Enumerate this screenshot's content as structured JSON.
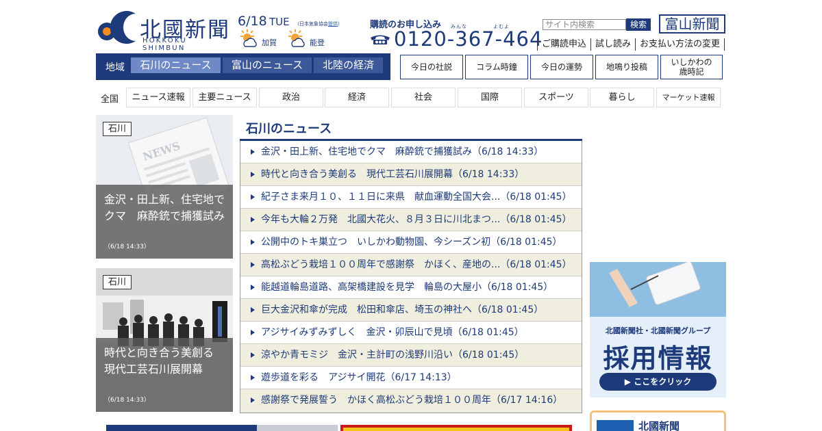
{
  "brand": {
    "name_jp": "北國新聞",
    "name_en": "HOKKOKU SHIMBUN",
    "color_primary": "#1d3a7a"
  },
  "header": {
    "date": "6/18",
    "weekday": "TUE",
    "weather_source_prefix": "（日本気象協会",
    "weather_source_link": "提供",
    "weather_source_suffix": "）",
    "weather": [
      {
        "place": "加賀",
        "icon": "sun-cloud-icon"
      },
      {
        "place": "能登",
        "icon": "sun-cloud-icon"
      }
    ],
    "subscribe_label": "購読のお申し込み",
    "phone_ruby_1": "みんな",
    "phone_ruby_2": "よむよ",
    "phone": "0120-367-464",
    "search_placeholder": "サイト内検索",
    "search_button": "検索",
    "toyama_logo": "富山新聞",
    "links": [
      "ご購読申込",
      "試し読み",
      "お支払い方法の変更"
    ]
  },
  "region_nav": {
    "label": "地域",
    "tabs": [
      {
        "label": "石川のニュース",
        "active": true
      },
      {
        "label": "富山のニュース",
        "active": false
      },
      {
        "label": "北陸の経済",
        "active": false
      }
    ]
  },
  "feature_buttons": [
    "今日の社説",
    "コラム時鐘",
    "今日の運勢",
    "地鳴り投稿",
    "いしかわの\n歳時記"
  ],
  "categories": {
    "all_label": "全国",
    "tabs": [
      "ニュース速報",
      "主要ニュース",
      "政治",
      "経済",
      "社会",
      "国際",
      "スポーツ",
      "暮らし",
      "マーケット速報"
    ]
  },
  "cards": [
    {
      "tag": "石川",
      "caption": "金沢・田上新、住宅地でクマ　麻酔銃で捕獲試み",
      "time": "（6/18 14:33）"
    },
    {
      "tag": "石川",
      "caption": "時代と向き合う美創る　現代工芸石川展開幕",
      "time": "（6/18 14:33）"
    }
  ],
  "news": {
    "title": "石川のニュース",
    "items": [
      "金沢・田上新、住宅地でクマ　麻酔銃で捕獲試み（6/18 14:33）",
      "時代と向き合う美創る　現代工芸石川展開幕（6/18 14:33）",
      "紀子さま来月１０、１１日に来県　献血運動全国大会...（6/18 01:45）",
      "今年も大輪２万発　北國大花火、８月３日に川北まつ...（6/18 01:45）",
      "公開中のトキ巣立つ　いしかわ動物園、今シーズン初（6/18 01:45）",
      "高松ぶどう栽培１００周年で感謝祭　かほく、産地の...（6/18 01:45）",
      "能越道輪島道路、高架橋建設を見学　輪島の大屋小（6/18 01:45）",
      "巨大金沢和傘が完成　松田和傘店、埼玉の神社へ（6/18 01:45）",
      "アジサイみずみずしく　金沢・卯辰山で見頃（6/18 01:45）",
      "涼やか青モミジ　金沢・主計町の浅野川沿い（6/18 01:45）",
      "遊歩道を彩る　アジサイ開花（6/17 14:13）",
      "感謝祭で発展誓う　かほく高松ぶどう栽培１００周年（6/17 14:16）"
    ]
  },
  "ads": {
    "recruit_sub": "北國新聞社・北國新聞グループ",
    "recruit_big": "採用情報",
    "recruit_cta": "▶ ここをクリック",
    "bottom_right_title": "北國新聞"
  }
}
